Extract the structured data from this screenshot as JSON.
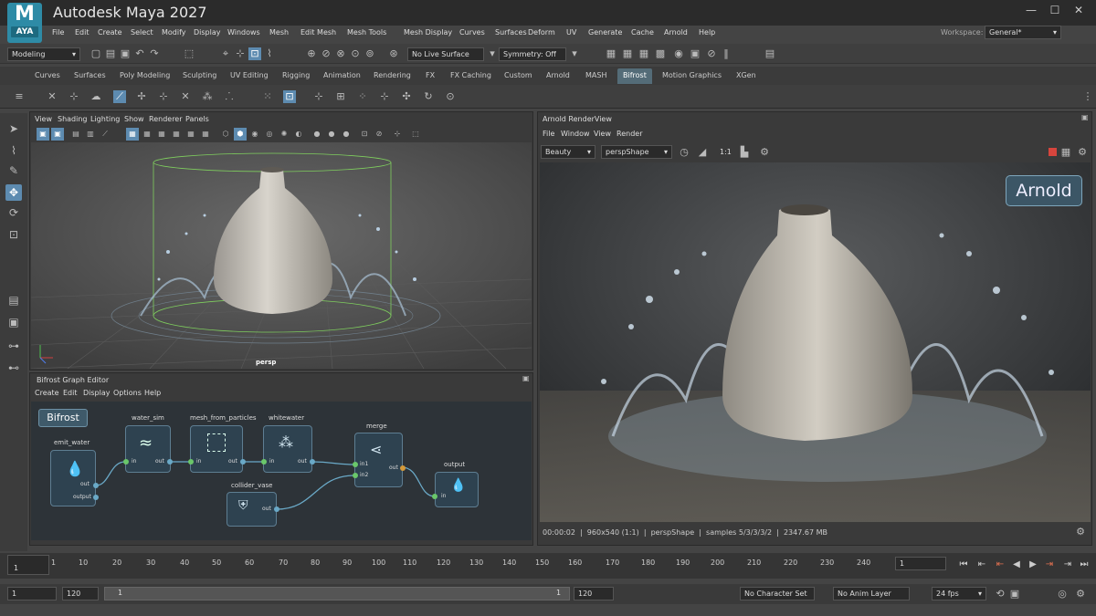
{
  "app": {
    "logo_letter": "M",
    "logo_sub": "AYA",
    "title": "Autodesk Maya 2027",
    "window_controls": [
      "—",
      "☐",
      "✕"
    ]
  },
  "menu": [
    "File",
    "Edit",
    "Create",
    "Select",
    "Modify",
    "Display",
    "Windows",
    "Mesh",
    "Edit Mesh",
    "Mesh Tools",
    "Mesh Display",
    "Curves",
    "Surfaces",
    "Deform",
    "UV",
    "Generate",
    "Cache",
    "Arnold",
    "Help"
  ],
  "workspace": {
    "label": "Workspace:",
    "value": "General*"
  },
  "toolbar": {
    "mode": "Modeling",
    "live_surface": "No Live Surface",
    "symmetry": "Symmetry: Off"
  },
  "shelf_tabs": [
    "Curves",
    "Surfaces",
    "Poly Modeling",
    "Sculpting",
    "UV Editing",
    "Rigging",
    "Animation",
    "Rendering",
    "FX",
    "FX Caching",
    "Custom",
    "Arnold",
    "MASH",
    "Bifrost",
    "Motion Graphics",
    "XGen"
  ],
  "active_shelf": "Bifrost",
  "viewport": {
    "menu": [
      "View",
      "Shading",
      "Lighting",
      "Show",
      "Renderer",
      "Panels"
    ],
    "camera": "persp"
  },
  "graph_editor": {
    "title": "Bifrost Graph Editor",
    "menu": [
      "Create",
      "Edit",
      "Display",
      "Options",
      "Help"
    ],
    "badge": "Bifrost",
    "nodes": {
      "emit_water": {
        "title": "emit_water",
        "out": "out",
        "output": "output"
      },
      "water_sim": {
        "title": "water_sim",
        "in": "in",
        "out": "out"
      },
      "mesh_from_particles": {
        "title": "mesh_from_particles",
        "in": "in",
        "out": "out"
      },
      "whitewater": {
        "title": "whitewater",
        "in": "in",
        "out": "out"
      },
      "merge": {
        "title": "merge",
        "in1": "in1",
        "in2": "in2",
        "out": "out"
      },
      "output": {
        "title": "output",
        "in": "in"
      },
      "collider_vase": {
        "title": "collider_vase",
        "out": "out"
      }
    }
  },
  "render_view": {
    "title": "Arnold RenderView",
    "menu": [
      "File",
      "Window",
      "View",
      "Render"
    ],
    "aov": "Beauty",
    "camera": "perspShape",
    "ratio": "1:1",
    "badge": "Arnold",
    "status": "00:00:02  |  960x540 (1:1)  |  perspShape  |  samples 5/3/3/3/2  |  2347.67 MB"
  },
  "timeline": {
    "ticks": [
      "1",
      "10",
      "20",
      "30",
      "40",
      "50",
      "60",
      "70",
      "80",
      "90",
      "100",
      "110",
      "120",
      "130",
      "140",
      "150",
      "160",
      "170",
      "180",
      "190",
      "200",
      "210",
      "220",
      "230",
      "240"
    ],
    "current_frame": "1",
    "frame_field": "1"
  },
  "range": {
    "start": "1",
    "anim_start": "120",
    "slider_start": "1",
    "slider_end": "1",
    "end": "120",
    "character_set": "No Character Set",
    "anim_layer": "No Anim Layer",
    "fps": "24 fps"
  }
}
